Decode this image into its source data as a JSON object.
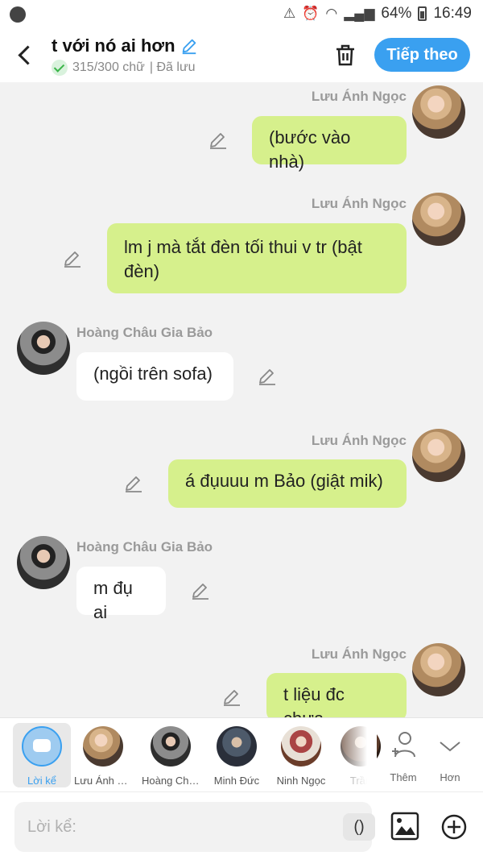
{
  "status": {
    "battery": "64%",
    "time": "16:49",
    "icons": [
      "vpn-icon",
      "alarm-icon",
      "wifi-icon",
      "signal-icon",
      "battery-icon"
    ]
  },
  "header": {
    "title": "t với nó ai hơn",
    "count": "315/300 chữ",
    "saved": "| Đã lưu",
    "next_label": "Tiếp theo"
  },
  "messages": [
    {
      "side": "right",
      "name": "Lưu Ánh Ngọc",
      "text": "(bước vào nhà)"
    },
    {
      "side": "right",
      "name": "Lưu Ánh Ngọc",
      "text": "lm j mà tắt đèn tối thui v tr (bật đèn)"
    },
    {
      "side": "left",
      "name": "Hoàng Châu Gia Bảo",
      "text": "(ngồi trên sofa)"
    },
    {
      "side": "right",
      "name": "Lưu Ánh Ngọc",
      "text": "á đụuuu m Bảo (giật mik)"
    },
    {
      "side": "left",
      "name": "Hoàng Châu Gia Bảo",
      "text": "m đụ ai"
    },
    {
      "side": "right",
      "name": "Lưu Ánh Ngọc",
      "text": "t liệu đc chưa"
    }
  ],
  "characters": [
    {
      "label": "Lời kể",
      "selected": true
    },
    {
      "label": "Lưu Ánh Ngọc"
    },
    {
      "label": "Hoàng Châu Gia Bảo"
    },
    {
      "label": "Minh Đức"
    },
    {
      "label": "Ninh Ngọc"
    },
    {
      "label": "Trần"
    }
  ],
  "actions": {
    "add_label": "Thêm",
    "more_label": "Hơn"
  },
  "input": {
    "placeholder": "Lời kể:",
    "paren": "()"
  },
  "colors": {
    "accent": "#3aa0f0",
    "bubble_green": "#d6f08c"
  }
}
